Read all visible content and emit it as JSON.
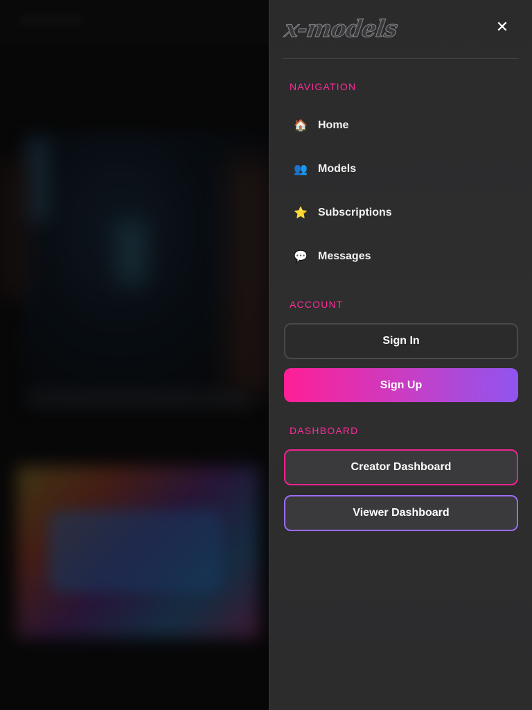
{
  "brand": {
    "logo_text": "x-models"
  },
  "drawer": {
    "close_glyph": "✕"
  },
  "navigation": {
    "title": "NAVIGATION",
    "items": [
      {
        "label": "Home",
        "icon": "house-icon",
        "glyph": "🏠"
      },
      {
        "label": "Models",
        "icon": "people-icon",
        "glyph": "👥"
      },
      {
        "label": "Subscriptions",
        "icon": "star-icon",
        "glyph": "⭐"
      },
      {
        "label": "Messages",
        "icon": "speech-bubble-icon",
        "glyph": "💬"
      }
    ]
  },
  "account": {
    "title": "ACCOUNT",
    "sign_in_label": "Sign In",
    "sign_up_label": "Sign Up"
  },
  "dashboard": {
    "title": "DASHBOARD",
    "creator_label": "Creator Dashboard",
    "viewer_label": "Viewer Dashboard"
  },
  "colors": {
    "accent_pink": "#ff2d9a",
    "accent_purple": "#8f55f0",
    "drawer_bg": "#2d2d2e"
  }
}
